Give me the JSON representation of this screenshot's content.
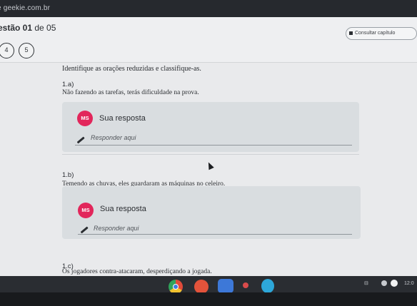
{
  "browser": {
    "url": "e geekie.com.br"
  },
  "header": {
    "question_prefix": "estão 01",
    "question_suffix": " de 05",
    "consult_label": "Consultar capítulo",
    "pager": [
      "4",
      "5"
    ]
  },
  "instruction": "Identifique as orações reduzidas e classifique-as.",
  "items": [
    {
      "label": "1.a)",
      "sentence": "Não fazendo as tarefas, terás dificuldade na prova.",
      "avatar": "MS",
      "response_title": "Sua resposta",
      "placeholder": "Responder aqui"
    },
    {
      "label": "1.b)",
      "sentence": "Temendo as chuvas, eles guardaram as máquinas no celeiro.",
      "avatar": "MS",
      "response_title": "Sua resposta",
      "placeholder": "Responder aqui"
    },
    {
      "label": "1.c)",
      "sentence": "Os jogadores contra-atacaram, desperdiçando a jogada."
    }
  ],
  "taskbar": {
    "clock": "12:0",
    "icons": [
      "chrome-icon",
      "app-orange-icon",
      "app-blue-icon",
      "app-red-icon",
      "app-cyan-icon"
    ]
  }
}
